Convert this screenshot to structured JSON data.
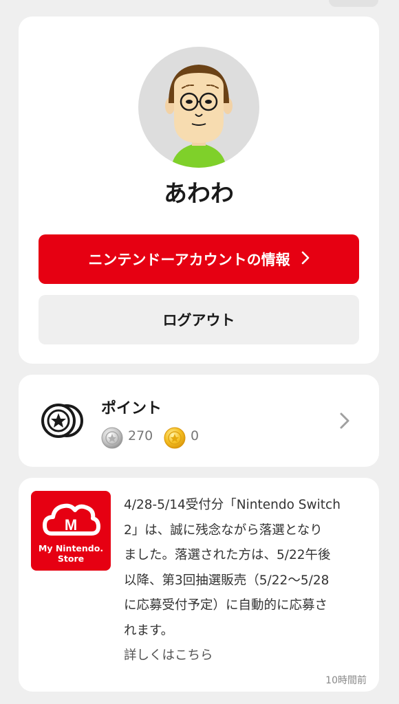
{
  "profile": {
    "username": "あわわ",
    "account_button_label": "ニンテンドーアカウントの情報",
    "logout_button_label": "ログアウト"
  },
  "points": {
    "title": "ポイント",
    "silver_points": "270",
    "gold_points": "0"
  },
  "news": {
    "store_logo_text_line1": "My Nintendo.",
    "store_logo_text_line2": "Store",
    "lines": [
      "4/28-5/14受付分「Nintendo Switch",
      "2」は、誠に残念ながら落選となり",
      "ました。落選された方は、5/22午後",
      "以降、第3回抽選販売（5/22〜5/28",
      "に応募受付予定）に自動的に応募さ",
      "れます。"
    ],
    "link_text": "詳しくはこちら",
    "timestamp": "10時間前"
  },
  "colors": {
    "brand_red": "#e60012",
    "background": "#efefef",
    "card": "#ffffff",
    "avatar_bg": "#dddddd"
  },
  "icons": {
    "account_chevron": "chevron-right-icon",
    "points": "points-coin-icon",
    "silver_coin": "silver-coin-icon",
    "gold_coin": "gold-coin-icon",
    "points_chevron": "chevron-right-icon"
  }
}
